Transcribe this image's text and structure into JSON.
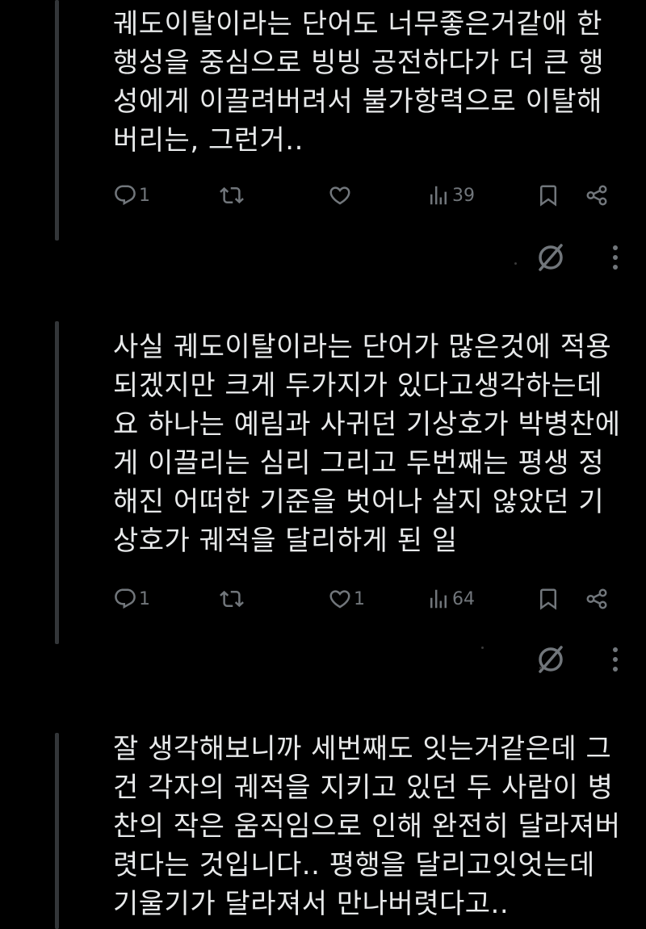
{
  "tweets": [
    {
      "text": "궤도이탈이라는 단어도 너무좋은거같애 한\n행성을 중심으로 빙빙 공전하다가 더 큰 행\n성에게 이끌려버려서 불가항력으로 이탈해\n버리는, 그런거..",
      "replies": "1",
      "retweets": "",
      "likes": "",
      "views": "39"
    },
    {
      "text": "사실 궤도이탈이라는 단어가 많은것에 적용\n되겠지만 크게 두가지가 있다고생각하는데\n요 하나는 예림과 사귀던 기상호가 박병찬에\n게 이끌리는 심리 그리고 두번째는 평생 정\n해진 어떠한 기준을 벗어나 살지 않았던 기\n상호가 궤적을 달리하게 된 일",
      "replies": "1",
      "retweets": "",
      "likes": "1",
      "views": "64"
    },
    {
      "text": "잘 생각해보니까 세번째도 잇는거같은데 그\n건 각자의 궤적을 지키고 있던 두 사람이 병\n찬의 작은 움직임으로 인해 완전히 달라져버\n렷다는 것입니다.. 평행을 달리고잇엇는데\n기울기가 달라져서 만나버렷다고..",
      "replies": "",
      "retweets": "",
      "likes": "",
      "views": ""
    }
  ],
  "icons": {
    "reply": "reply-icon",
    "retweet": "retweet-icon",
    "like": "heart-icon",
    "views": "views-icon",
    "bookmark": "bookmark-icon",
    "share": "share-icon",
    "hide": "hide-reply-icon",
    "more": "more-icon"
  },
  "colors": {
    "background": "#000000",
    "text": "#e7e9ea",
    "secondary": "#71767b",
    "thread_line": "#333639"
  }
}
